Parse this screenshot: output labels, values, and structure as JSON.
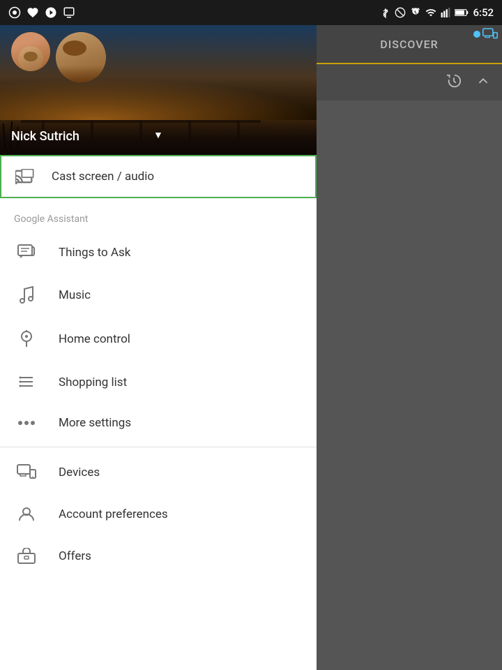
{
  "statusBar": {
    "time": "6:52",
    "icons": {
      "bluetooth": "⬥",
      "block": "⊘",
      "alarm": "⏰",
      "wifi": "▲",
      "signal": "▲",
      "battery": "▮"
    }
  },
  "drawer": {
    "user": {
      "name": "Nick Sutrich",
      "dropdownArrow": "▼"
    },
    "castItem": {
      "label": "Cast screen / audio"
    },
    "googleAssistant": {
      "sectionLabel": "Google Assistant",
      "menuItems": [
        {
          "id": "things-to-ask",
          "label": "Things to Ask",
          "icon": "speech"
        },
        {
          "id": "music",
          "label": "Music",
          "icon": "music"
        },
        {
          "id": "home-control",
          "label": "Home control",
          "icon": "bulb"
        },
        {
          "id": "shopping-list",
          "label": "Shopping list",
          "icon": "list"
        },
        {
          "id": "more-settings",
          "label": "More settings",
          "icon": "dots"
        }
      ]
    },
    "bottomItems": [
      {
        "id": "devices",
        "label": "Devices",
        "icon": "devices"
      },
      {
        "id": "account-preferences",
        "label": "Account preferences",
        "icon": "account"
      },
      {
        "id": "offers",
        "label": "Offers",
        "icon": "gift"
      }
    ]
  },
  "rightPanel": {
    "discoverLabel": "DISCOVER",
    "deviceIconLabel": "🖥"
  }
}
